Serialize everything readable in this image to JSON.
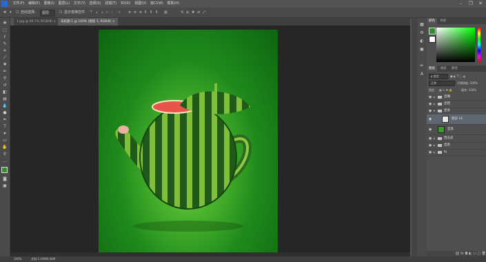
{
  "menubar": {
    "items": [
      "文件(F)",
      "编辑(E)",
      "图像(I)",
      "图层(L)",
      "文字(Y)",
      "选择(S)",
      "滤镜(T)",
      "3D(D)",
      "视图(V)",
      "窗口(W)",
      "帮助(H)"
    ]
  },
  "window_controls": {
    "minimize": "–",
    "restore": "❐",
    "close": "✕"
  },
  "options_bar": {
    "auto_select_label": "自动选择:",
    "auto_select_value": "图层",
    "show_transform_label": "显示变换控件"
  },
  "tabs": [
    {
      "label": "1.jpg @ 66.7% (RGB/8) ×"
    },
    {
      "label": "未标题-1 @ 100% (图层 1, RGB/8) ×"
    }
  ],
  "colors": {
    "foreground": "#2f8f2a",
    "background": "#ffffff",
    "accent_panel": "#5e6670"
  },
  "right_panel": {
    "top_tabs": [
      {
        "label": "颜色"
      },
      {
        "label": "色板"
      }
    ],
    "layer_tabs": [
      {
        "label": "图层"
      },
      {
        "label": "通道"
      },
      {
        "label": "路径"
      }
    ],
    "kind_label": "ρ 类型",
    "blend_mode": "正常",
    "opacity_label": "不透明度: 100%",
    "lock_label": "锁定:",
    "fill_label": "填充: 100%",
    "layers": [
      {
        "name": "壶嘴",
        "type": "folder"
      },
      {
        "name": "壶把",
        "type": "folder"
      },
      {
        "name": "壶身",
        "type": "folder"
      },
      {
        "name": "图层 16",
        "type": "layer",
        "selected": true
      },
      {
        "name": "壶盖",
        "type": "layer"
      },
      {
        "name": "西瓜皮",
        "type": "folder"
      },
      {
        "name": "壶底",
        "type": "folder"
      },
      {
        "name": "bj",
        "type": "folder"
      }
    ]
  },
  "status": {
    "zoom": "100%",
    "doc_size": "文档:1.03M/6.06M"
  }
}
